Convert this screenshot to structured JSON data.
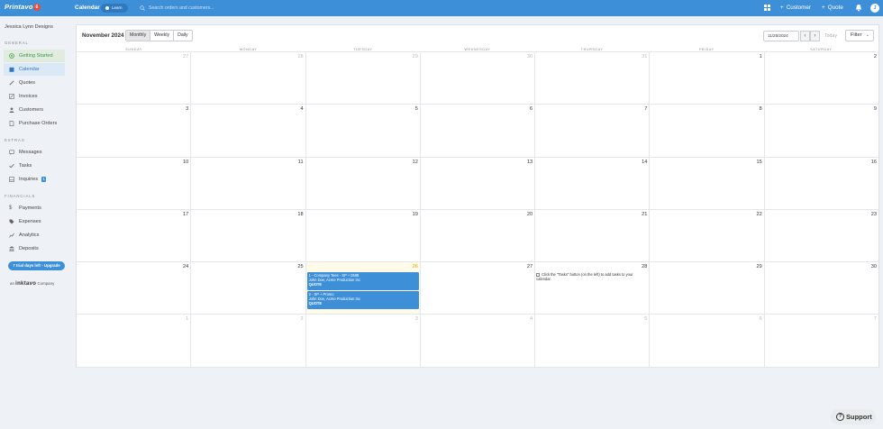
{
  "topbar": {
    "brand": "Printavo",
    "brand_badge": "6",
    "title": "Calendar",
    "learn_label": "Learn",
    "search_placeholder": "Search orders and customers...",
    "customer_label": "Customer",
    "quote_label": "Quote",
    "avatar_initial": "J"
  },
  "sidebar": {
    "company_name": "Jessica Lynn Designs",
    "section_general": "GENERAL",
    "section_extras": "EXTRAS",
    "section_financials": "FINANCIALS",
    "items": {
      "getting_started": "Getting Started",
      "calendar": "Calendar",
      "quotes": "Quotes",
      "invoices": "Invoices",
      "customers": "Customers",
      "purchase_orders": "Purchase Orders",
      "messages": "Messages",
      "tasks": "Tasks",
      "inquiries": "Inquiries",
      "inquiries_count": "1",
      "payments": "Payments",
      "expenses": "Expenses",
      "analytics": "Analytics",
      "deposits": "Deposits"
    },
    "trial_label": "7 trial days left - Upgrade",
    "inktavo_prefix": "an",
    "inktavo_brand": "inktavo",
    "inktavo_suffix": "Company"
  },
  "calendar": {
    "month_title": "November 2024",
    "views": [
      "Monthly",
      "Weekly",
      "Daily"
    ],
    "active_view": "Monthly",
    "date_value": "11/26/2024",
    "prev_arrow": "‹",
    "next_arrow": "›",
    "today_label": "Today",
    "filter_label": "Filter",
    "weekdays": [
      "SUNDAY",
      "MONDAY",
      "TUESDAY",
      "WEDNESDAY",
      "THURSDAY",
      "FRIDAY",
      "SATURDAY"
    ],
    "weeks": [
      [
        "27",
        "28",
        "29",
        "30",
        "31",
        "1",
        "2"
      ],
      [
        "3",
        "4",
        "5",
        "6",
        "7",
        "8",
        "9"
      ],
      [
        "10",
        "11",
        "12",
        "13",
        "14",
        "15",
        "16"
      ],
      [
        "17",
        "18",
        "19",
        "20",
        "21",
        "22",
        "23"
      ],
      [
        "24",
        "25",
        "26",
        "27",
        "28",
        "29",
        "30"
      ],
      [
        "1",
        "2",
        "3",
        "4",
        "5",
        "6",
        "7"
      ]
    ],
    "events": [
      {
        "title": "1 - Company Tees - SP + EMB",
        "customer": "John Doe, Acme Production Inc",
        "tag": "QUOTE"
      },
      {
        "title": "2 - SP + Promo",
        "customer": "John Doe, Acme Production Inc",
        "tag": "QUOTE"
      }
    ],
    "task_hint": "Click the \"Tasks\" button (on the left) to add tasks to your calendar."
  },
  "support_label": "Support",
  "colors": {
    "primary": "#3d8fd8",
    "active_green": "#3a9a4a",
    "today_bg": "#fffbe8"
  }
}
